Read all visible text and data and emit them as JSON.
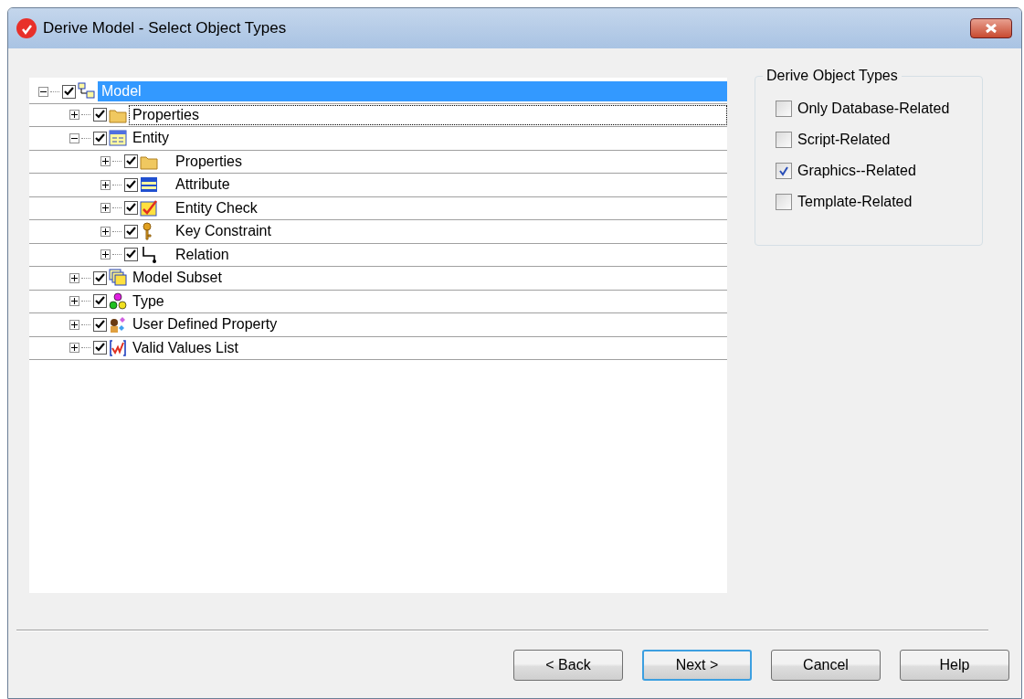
{
  "window": {
    "title": "Derive Model - Select Object Types"
  },
  "tree": [
    {
      "label": "Model",
      "kind": "model",
      "checked": true,
      "expanded": true,
      "selected": true,
      "focused": false,
      "children": [
        {
          "label": "Properties",
          "kind": "folder",
          "checked": true,
          "expanded": false,
          "selected": false,
          "focused": true
        },
        {
          "label": "Entity",
          "kind": "entity",
          "checked": true,
          "expanded": true,
          "selected": false,
          "focused": false,
          "children": [
            {
              "label": "Properties",
              "kind": "folder",
              "checked": true,
              "expanded": false,
              "selected": false,
              "focused": false
            },
            {
              "label": "Attribute",
              "kind": "attribute",
              "checked": true,
              "expanded": false,
              "selected": false,
              "focused": false
            },
            {
              "label": "Entity Check",
              "kind": "check",
              "checked": true,
              "expanded": false,
              "selected": false,
              "focused": false
            },
            {
              "label": "Key Constraint",
              "kind": "key",
              "checked": true,
              "expanded": false,
              "selected": false,
              "focused": false
            },
            {
              "label": "Relation",
              "kind": "relation",
              "checked": true,
              "expanded": false,
              "selected": false,
              "focused": false
            }
          ]
        },
        {
          "label": "Model Subset",
          "kind": "subset",
          "checked": true,
          "expanded": false,
          "selected": false,
          "focused": false
        },
        {
          "label": "Type",
          "kind": "type",
          "checked": true,
          "expanded": false,
          "selected": false,
          "focused": false
        },
        {
          "label": "User Defined Property",
          "kind": "udp",
          "checked": true,
          "expanded": false,
          "selected": false,
          "focused": false
        },
        {
          "label": "Valid Values List",
          "kind": "validvalues",
          "checked": true,
          "expanded": false,
          "selected": false,
          "focused": false
        }
      ]
    }
  ],
  "derive_object_types": {
    "title": "Derive Object Types",
    "options": [
      {
        "label": "Only Database-Related",
        "checked": false
      },
      {
        "label": "Script-Related",
        "checked": false
      },
      {
        "label": "Graphics--Related",
        "checked": true
      },
      {
        "label": "Template-Related",
        "checked": false
      }
    ]
  },
  "buttons": [
    {
      "label": "< Back",
      "default": false
    },
    {
      "label": "Next >",
      "default": true
    },
    {
      "label": "Cancel",
      "default": false
    },
    {
      "label": "Help",
      "default": false
    }
  ]
}
